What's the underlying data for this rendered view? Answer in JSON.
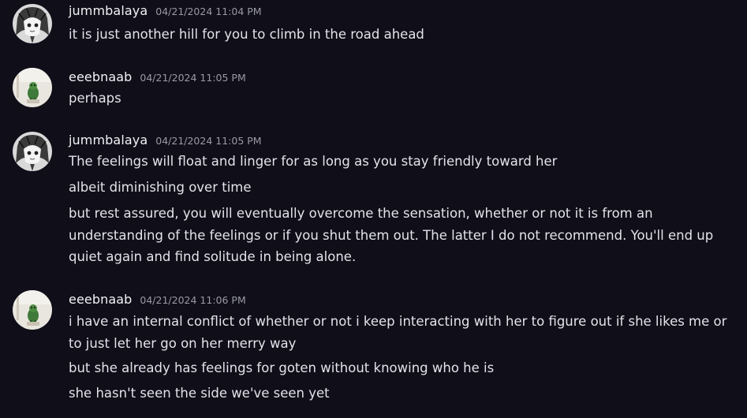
{
  "messages": [
    {
      "username": "jummbalaya",
      "timestamp": "04/21/2024 11:04 PM",
      "avatar": "anime-character-avatar",
      "lines": [
        "it is just another hill for you to climb in the road ahead"
      ]
    },
    {
      "username": "eeebnaab",
      "timestamp": "04/21/2024 11:05 PM",
      "avatar": "green-figure-avatar",
      "lines": [
        "perhaps"
      ]
    },
    {
      "username": "jummbalaya",
      "timestamp": "04/21/2024 11:05 PM",
      "avatar": "anime-character-avatar",
      "lines": [
        "The feelings will float and linger for as long as you stay friendly toward her",
        "albeit diminishing over time",
        "but rest assured, you will eventually overcome the sensation, whether or not it is from an understanding of the feelings or if you shut them out. The latter I do not recommend. You'll end up quiet again and find solitude in being alone."
      ]
    },
    {
      "username": "eeebnaab",
      "timestamp": "04/21/2024 11:06 PM",
      "avatar": "green-figure-avatar",
      "lines": [
        "i have an internal conflict of whether or not i keep interacting with her to figure out if she likes me or to just let her go on her merry way",
        "but she already has feelings for goten without knowing who he is",
        "she hasn't seen the side we've seen yet"
      ]
    }
  ],
  "colors": {
    "background": "#0f0e19",
    "username": "#f2f3f5",
    "timestamp": "#9a9aa6",
    "text": "#e3e3ea"
  }
}
